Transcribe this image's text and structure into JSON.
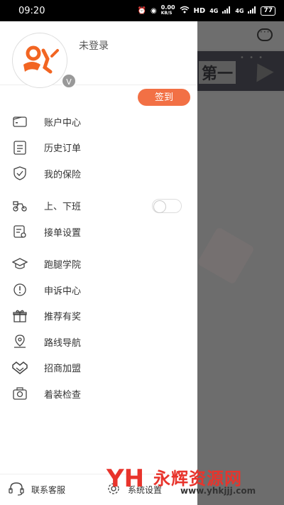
{
  "status_bar": {
    "time": "09:20",
    "net_speed_value": "0.00",
    "net_speed_unit": "KB/S",
    "hd_label": "HD",
    "signal1": "4G",
    "signal2": "4G",
    "battery": "77"
  },
  "profile": {
    "login_status": "未登录",
    "avatar_badge": "V"
  },
  "signin_label": "签到",
  "menu": {
    "group1": [
      {
        "label": "账户中心",
        "icon": "wallet-icon"
      },
      {
        "label": "历史订单",
        "icon": "order-list-icon"
      },
      {
        "label": "我的保险",
        "icon": "shield-icon"
      }
    ],
    "group2": [
      {
        "label": "上、下班",
        "icon": "scooter-icon"
      },
      {
        "label": "接单设置",
        "icon": "order-settings-icon"
      }
    ],
    "group3": [
      {
        "label": "跑腿学院",
        "icon": "graduation-cap-icon"
      },
      {
        "label": "申诉中心",
        "icon": "alert-circle-icon"
      },
      {
        "label": "推荐有奖",
        "icon": "gift-icon"
      },
      {
        "label": "路线导航",
        "icon": "map-pin-icon"
      },
      {
        "label": "招商加盟",
        "icon": "handshake-icon"
      },
      {
        "label": "着装检查",
        "icon": "camera-icon"
      }
    ]
  },
  "toggle_on": false,
  "footer": {
    "customer_service": "联系客服",
    "settings": "系统设置"
  },
  "background": {
    "banner_text": "第一"
  },
  "watermark": {
    "logo": "YH",
    "name": "永辉资源网",
    "url": "www.yhkjjj.com"
  },
  "colors": {
    "accent": "#f27045",
    "watermark": "#e8342c"
  }
}
